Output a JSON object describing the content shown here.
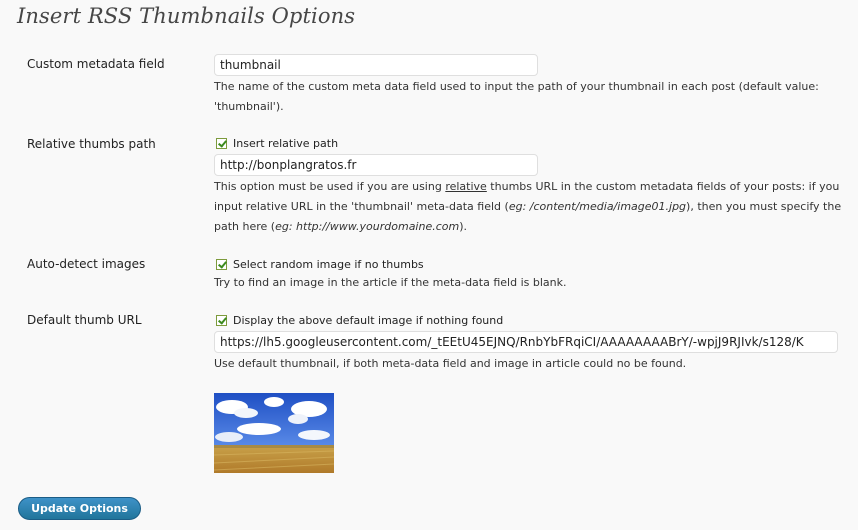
{
  "page_title": "Insert RSS Thumbnails Options",
  "custom_field": {
    "label": "Custom metadata field",
    "value": "thumbnail",
    "description": "The name of the custom meta data field used to input the path of your thumbnail in each post (default value: 'thumbnail')."
  },
  "relative": {
    "label": "Relative thumbs path",
    "checkbox_label": "Insert relative path",
    "checked": true,
    "value": "http://bonplangratos.fr",
    "desc_1": "This option must be used if you are using ",
    "desc_link": "relative",
    "desc_2": " thumbs URL in the custom metadata fields of your posts: if you input relative URL in the 'thumbnail' meta-data field (",
    "desc_eg1": "eg: /content/media/image01.jpg",
    "desc_3": "), then you must specify the path here (",
    "desc_eg2": "eg: http://www.yourdomaine.com",
    "desc_4": ")."
  },
  "autodetect": {
    "label": "Auto-detect images",
    "checkbox_label": "Select random image if no thumbs",
    "checked": true,
    "description": "Try to find an image in the article if the meta-data field is blank."
  },
  "default_thumb": {
    "label": "Default thumb URL",
    "checkbox_label": "Display the above default image if nothing found",
    "checked": true,
    "value": "https://lh5.googleusercontent.com/_tEEtU45EJNQ/RnbYbFRqiCI/AAAAAAAABrY/-wpjJ9RJIvk/s128/K",
    "description": "Use default thumbnail, if both meta-data field and image in article could no be found."
  },
  "update_button": "Update Options"
}
